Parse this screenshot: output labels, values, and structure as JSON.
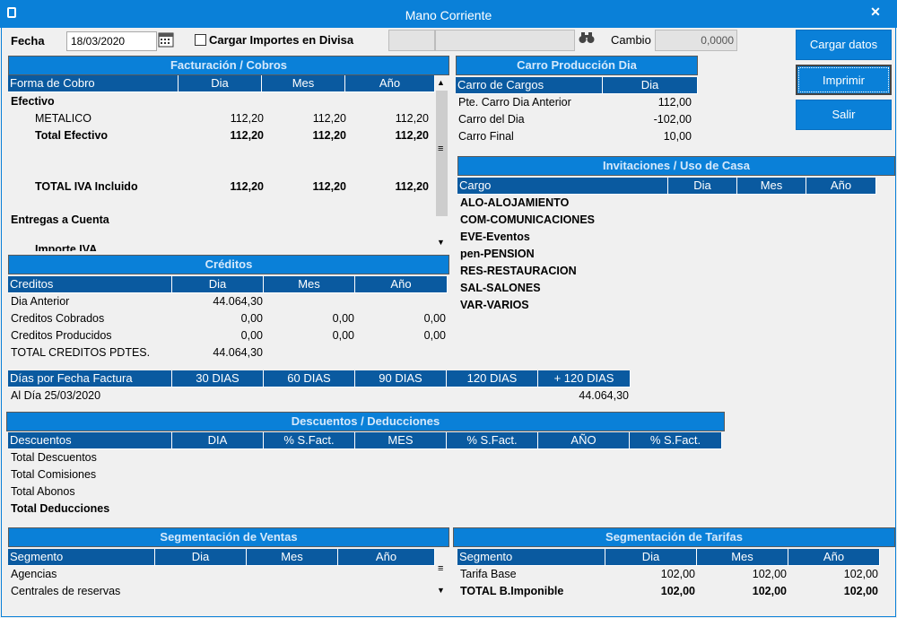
{
  "window": {
    "title": "Mano Corriente",
    "close": "✕"
  },
  "toolbar": {
    "fecha_label": "Fecha",
    "fecha_value": "18/03/2020",
    "divisa_label": "Cargar Importes en Divisa",
    "cambio_label": "Cambio",
    "cambio_value": "0,0000",
    "cargar": "Cargar datos",
    "imprimir": "Imprimir",
    "salir": "Salir"
  },
  "facturacion": {
    "title": "Facturación / Cobros",
    "cols": [
      "Forma de Cobro",
      "Dia",
      "Mes",
      "Año"
    ],
    "efectivo": "Efectivo",
    "rows": [
      {
        "label": "METALICO",
        "dia": "112,20",
        "mes": "112,20",
        "anio": "112,20"
      },
      {
        "label": "Total Efectivo",
        "dia": "112,20",
        "mes": "112,20",
        "anio": "112,20"
      },
      {
        "label": "TOTAL IVA Incluido",
        "dia": "112,20",
        "mes": "112,20",
        "anio": "112,20"
      }
    ],
    "entregas": "Entregas a Cuenta",
    "cut": "Importe IVA"
  },
  "carro": {
    "title": "Carro Producción Dia",
    "cols": [
      "Carro de Cargos",
      "Dia"
    ],
    "rows": [
      {
        "label": "Pte. Carro Dia Anterior",
        "val": "112,00"
      },
      {
        "label": "Carro del Dia",
        "val": "-102,00"
      },
      {
        "label": "Carro Final",
        "val": "10,00"
      }
    ]
  },
  "invitaciones": {
    "title": "Invitaciones / Uso de Casa",
    "cols": [
      "Cargo",
      "Dia",
      "Mes",
      "Año"
    ],
    "items": [
      "ALO-ALOJAMIENTO",
      "COM-COMUNICACIONES",
      "EVE-Eventos",
      "pen-PENSION",
      "RES-RESTAURACION",
      "SAL-SALONES",
      "VAR-VARIOS"
    ]
  },
  "creditos": {
    "title": "Créditos",
    "cols": [
      "Creditos",
      "Dia",
      "Mes",
      "Año"
    ],
    "rows": [
      {
        "label": "Dia Anterior",
        "dia": "44.064,30",
        "mes": "",
        "anio": ""
      },
      {
        "label": "Creditos Cobrados",
        "dia": "0,00",
        "mes": "0,00",
        "anio": "0,00"
      },
      {
        "label": "Creditos Producidos",
        "dia": "0,00",
        "mes": "0,00",
        "anio": "0,00"
      },
      {
        "label": "TOTAL CREDITOS PDTES.",
        "dia": "44.064,30",
        "mes": "",
        "anio": ""
      }
    ],
    "dias_cols": [
      "Días por Fecha Factura",
      "30 DIAS",
      "60 DIAS",
      "90 DIAS",
      "120 DIAS",
      "+ 120 DIAS"
    ],
    "al_dia_label": "Al Día 25/03/2020",
    "al_dia_value": "44.064,30"
  },
  "descuentos": {
    "title": "Descuentos / Deducciones",
    "cols": [
      "Descuentos",
      "DIA",
      "% S.Fact.",
      "MES",
      "% S.Fact.",
      "AÑO",
      "% S.Fact."
    ],
    "rows": [
      "Total Descuentos",
      "Total Comisiones",
      "Total Abonos",
      "Total Deducciones"
    ]
  },
  "seg_ventas": {
    "title": "Segmentación de Ventas",
    "cols": [
      "Segmento",
      "Dia",
      "Mes",
      "Año"
    ],
    "rows": [
      "Agencias",
      "Centrales de reservas"
    ]
  },
  "seg_tarifas": {
    "title": "Segmentación de Tarifas",
    "cols": [
      "Segmento",
      "Dia",
      "Mes",
      "Año"
    ],
    "rows": [
      {
        "label": "Tarifa Base",
        "dia": "102,00",
        "mes": "102,00",
        "anio": "102,00"
      },
      {
        "label": "TOTAL B.Imponible",
        "dia": "102,00",
        "mes": "102,00",
        "anio": "102,00"
      }
    ]
  },
  "glyphs": {
    "calendar": "calendar-icon",
    "binoculars": "binoculars-icon",
    "up": "▲",
    "down": "▼",
    "grip": "≡"
  },
  "colors": {
    "title_bar": "#0a80d8",
    "grid_header": "#0a5aa0",
    "section_header": "#0a80d8"
  }
}
